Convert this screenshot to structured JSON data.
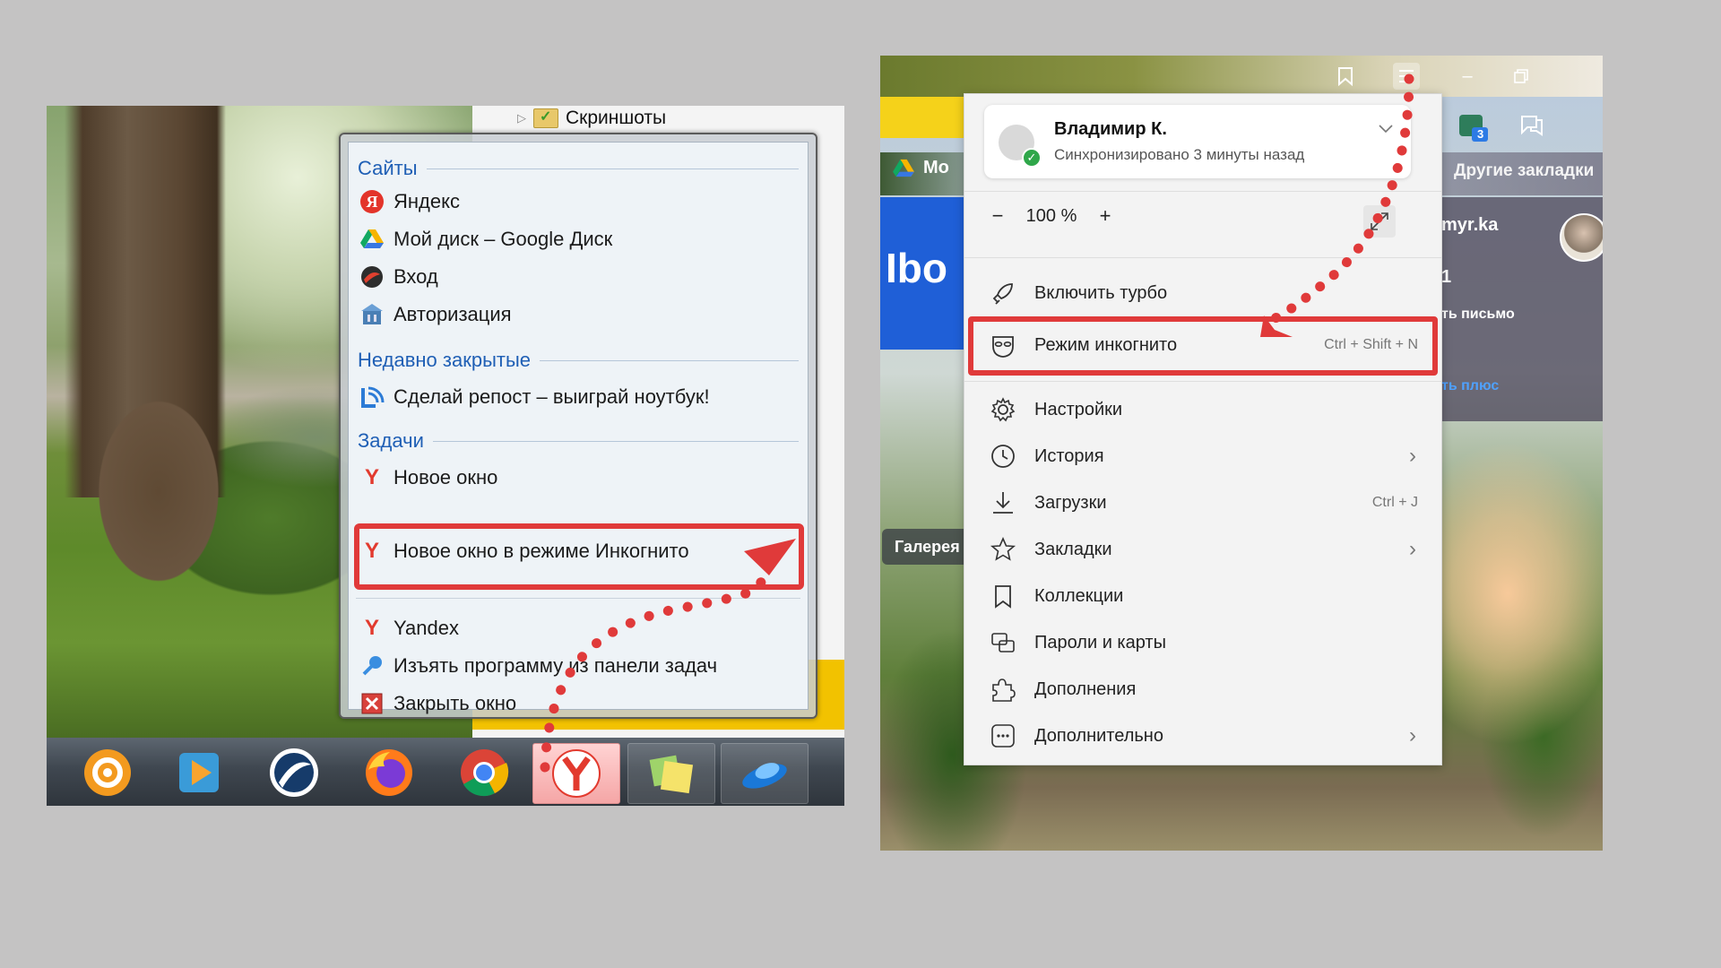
{
  "left": {
    "folder_label": "Скриншоты",
    "jumplist": {
      "sections": {
        "sites": "Сайты",
        "recent": "Недавно закрытые",
        "tasks": "Задачи"
      },
      "sites": [
        {
          "label": "Яндекс",
          "icon": "yandex-icon"
        },
        {
          "label": "Мой диск – Google Диск",
          "icon": "google-drive-icon"
        },
        {
          "label": "Вход",
          "icon": "login-icon"
        },
        {
          "label": "Авторизация",
          "icon": "authorization-icon"
        }
      ],
      "recent": [
        {
          "label": "Сделай репост – выиграй ноутбук!",
          "icon": "repost-icon"
        }
      ],
      "tasks": [
        {
          "label": "Новое окно",
          "icon": "yandex-browser-icon"
        },
        {
          "label": "Новое окно в режиме Инкогнито",
          "icon": "yandex-browser-icon"
        }
      ],
      "pinned": [
        {
          "label": "Yandex",
          "icon": "yandex-browser-icon"
        },
        {
          "label": "Изъять программу из панели задач",
          "icon": "unpin-icon"
        },
        {
          "label": "Закрыть окно",
          "icon": "close-window-icon"
        }
      ]
    },
    "taskbar_icons": [
      "gear-app-icon",
      "media-player-icon",
      "app-icon",
      "firefox-icon",
      "chrome-icon",
      "yandex-browser-icon",
      "sticky-notes-icon",
      "yandex-disk-icon"
    ]
  },
  "right": {
    "bookmarks": {
      "drive_label": "Мо",
      "other_label": "Другие закладки"
    },
    "page_bits": {
      "blue_card_text": "Ibo",
      "mail_domain": "myr.ka",
      "mail_count": "1",
      "mail_write": "ть письмо",
      "mail_plus": "ть плюс",
      "gallery": "Галерея",
      "badge_count": "3"
    },
    "menu": {
      "profile": {
        "name": "Владимир К.",
        "sync_status": "Синхронизировано 3 минуты назад"
      },
      "zoom": {
        "minus": "−",
        "value": "100 %",
        "plus": "+"
      },
      "items": [
        {
          "label": "Включить турбо",
          "icon": "rocket-icon",
          "shortcut": "",
          "submenu": false
        },
        {
          "label": "Режим инкогнито",
          "icon": "incognito-mask-icon",
          "shortcut": "Ctrl + Shift + N",
          "submenu": false
        },
        {
          "label": "Настройки",
          "icon": "gear-icon",
          "shortcut": "",
          "submenu": false
        },
        {
          "label": "История",
          "icon": "clock-icon",
          "shortcut": "",
          "submenu": true
        },
        {
          "label": "Загрузки",
          "icon": "download-icon",
          "shortcut": "Ctrl + J",
          "submenu": false
        },
        {
          "label": "Закладки",
          "icon": "star-icon",
          "shortcut": "",
          "submenu": true
        },
        {
          "label": "Коллекции",
          "icon": "bookmark-icon",
          "shortcut": "",
          "submenu": false
        },
        {
          "label": "Пароли и карты",
          "icon": "passwords-cards-icon",
          "shortcut": "",
          "submenu": false
        },
        {
          "label": "Дополнения",
          "icon": "puzzle-icon",
          "shortcut": "",
          "submenu": false
        },
        {
          "label": "Дополнительно",
          "icon": "more-dots-icon",
          "shortcut": "",
          "submenu": true
        }
      ]
    }
  },
  "colors": {
    "highlight": "#e03a3a",
    "jumplist_section": "#1f5fb5",
    "yandex_red": "#e23a2e"
  }
}
